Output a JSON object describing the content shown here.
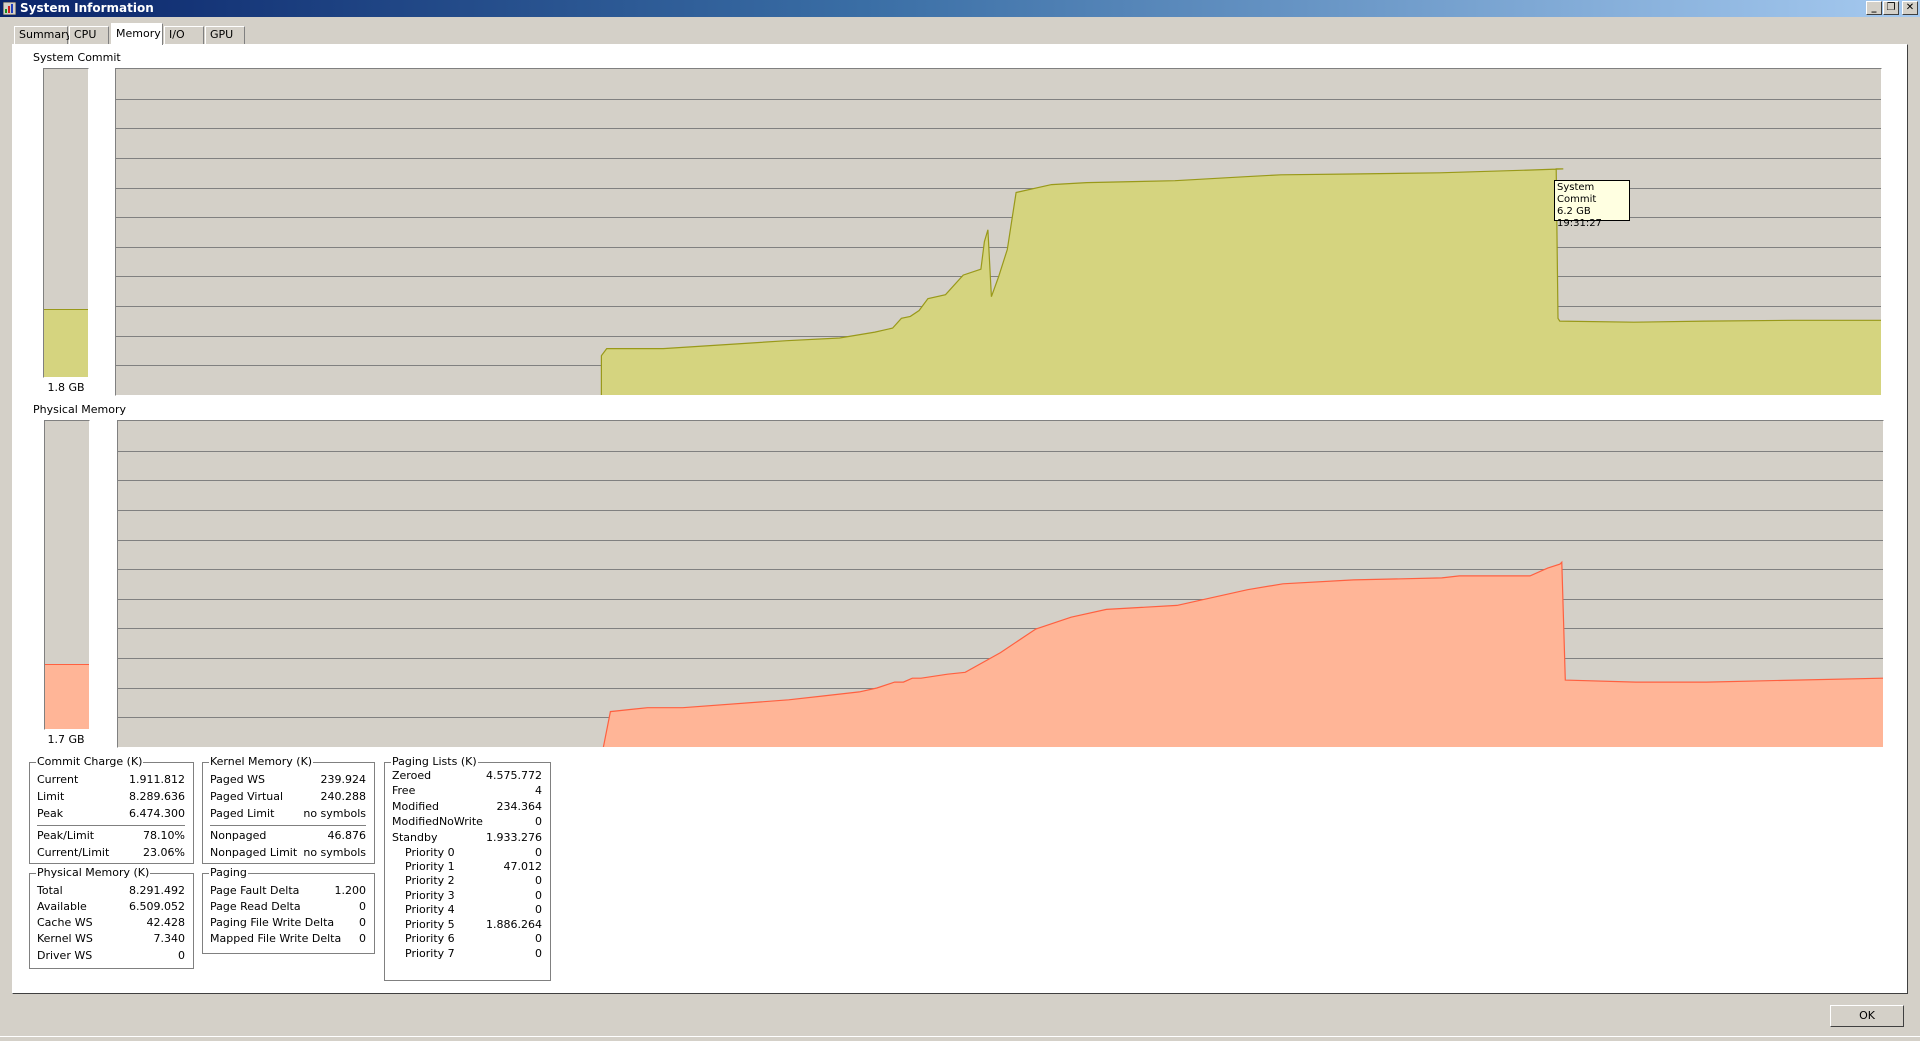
{
  "window": {
    "title": "System Information",
    "app_icon": "system-info-icon"
  },
  "tabs": [
    {
      "label": "Summary",
      "active": false
    },
    {
      "label": "CPU",
      "active": false
    },
    {
      "label": "Memory",
      "active": true
    },
    {
      "label": "I/O",
      "active": false
    },
    {
      "label": "GPU",
      "active": false
    }
  ],
  "colors": {
    "commit_fill": "#d5d47f",
    "commit_line": "#99991a",
    "physical_fill": "#ffb597",
    "physical_line": "#ff6040",
    "graph_bg": "#d4d0c8",
    "grid": "#808080"
  },
  "system_commit": {
    "label": "System Commit",
    "gauge_value": "1.8 GB",
    "gauge_fraction": 0.22,
    "tooltip": {
      "line1": "System Commit",
      "line2": "6.2 GB",
      "line3": "19:31:27"
    }
  },
  "physical_memory": {
    "label": "Physical Memory",
    "gauge_value": "1.7 GB",
    "gauge_fraction": 0.21
  },
  "commit_charge": {
    "title": "Commit Charge (K)",
    "rows": [
      {
        "label": "Current",
        "value": "1.911.812"
      },
      {
        "label": "Limit",
        "value": "8.289.636"
      },
      {
        "label": "Peak",
        "value": "6.474.300"
      }
    ],
    "rows2": [
      {
        "label": "Peak/Limit",
        "value": "78.10%"
      },
      {
        "label": "Current/Limit",
        "value": "23.06%"
      }
    ]
  },
  "kernel_memory": {
    "title": "Kernel Memory (K)",
    "rows": [
      {
        "label": "Paged WS",
        "value": "239.924"
      },
      {
        "label": "Paged Virtual",
        "value": "240.288"
      },
      {
        "label": "Paged Limit",
        "value": "no symbols"
      }
    ],
    "rows2": [
      {
        "label": "Nonpaged",
        "value": "46.876"
      },
      {
        "label": "Nonpaged Limit",
        "value": "no symbols"
      }
    ]
  },
  "paging_lists": {
    "title": "Paging Lists (K)",
    "rows": [
      {
        "label": "Zeroed",
        "value": "4.575.772"
      },
      {
        "label": "Free",
        "value": "4"
      },
      {
        "label": "Modified",
        "value": "234.364"
      },
      {
        "label": "ModifiedNoWrite",
        "value": "0"
      },
      {
        "label": "Standby",
        "value": "1.933.276"
      }
    ],
    "priorities": [
      {
        "label": "Priority 0",
        "value": "0"
      },
      {
        "label": "Priority 1",
        "value": "47.012"
      },
      {
        "label": "Priority 2",
        "value": "0"
      },
      {
        "label": "Priority 3",
        "value": "0"
      },
      {
        "label": "Priority 4",
        "value": "0"
      },
      {
        "label": "Priority 5",
        "value": "1.886.264"
      },
      {
        "label": "Priority 6",
        "value": "0"
      },
      {
        "label": "Priority 7",
        "value": "0"
      }
    ]
  },
  "physical_memory_k": {
    "title": "Physical Memory (K)",
    "rows": [
      {
        "label": "Total",
        "value": "8.291.492"
      },
      {
        "label": "Available",
        "value": "6.509.052"
      },
      {
        "label": "Cache WS",
        "value": "42.428"
      },
      {
        "label": "Kernel WS",
        "value": "7.340"
      },
      {
        "label": "Driver WS",
        "value": "0"
      }
    ]
  },
  "paging": {
    "title": "Paging",
    "rows": [
      {
        "label": "Page Fault Delta",
        "value": "1.200"
      },
      {
        "label": "Page Read Delta",
        "value": "0"
      },
      {
        "label": "Paging File Write Delta",
        "value": "0"
      },
      {
        "label": "Mapped File Write Delta",
        "value": "0"
      }
    ]
  },
  "ok_button": {
    "label": "OK"
  },
  "chart_data": [
    {
      "type": "area",
      "name": "system-commit-history",
      "ylim": [
        0,
        8.29
      ],
      "grid_rows": 11,
      "points_x_fraction": [
        0,
        0.274,
        0.275,
        0.278,
        0.31,
        0.38,
        0.41,
        0.43,
        0.44,
        0.445,
        0.45,
        0.455,
        0.46,
        0.47,
        0.48,
        0.49,
        0.492,
        0.494,
        0.496,
        0.5,
        0.505,
        0.51,
        0.53,
        0.55,
        0.6,
        0.64,
        0.66,
        0.7,
        0.75,
        0.8,
        0.82,
        0.816,
        0.817,
        0.818,
        0.86,
        0.9,
        0.95,
        1.0
      ],
      "values_gb": [
        null,
        null,
        1.0,
        1.18,
        1.18,
        1.38,
        1.45,
        1.6,
        1.7,
        1.95,
        2.0,
        2.15,
        2.45,
        2.55,
        3.05,
        3.2,
        3.9,
        4.2,
        2.5,
        3.0,
        3.7,
        5.15,
        5.35,
        5.4,
        5.45,
        5.55,
        5.6,
        5.62,
        5.65,
        5.72,
        5.75,
        5.75,
        1.95,
        1.88,
        1.85,
        1.88,
        1.9,
        1.9
      ]
    },
    {
      "type": "area",
      "name": "physical-memory-history",
      "ylim": [
        0,
        8.29
      ],
      "grid_rows": 11,
      "points_x_fraction": [
        0,
        0.274,
        0.275,
        0.279,
        0.3,
        0.32,
        0.38,
        0.4,
        0.42,
        0.43,
        0.44,
        0.445,
        0.45,
        0.455,
        0.47,
        0.48,
        0.5,
        0.52,
        0.54,
        0.56,
        0.58,
        0.6,
        0.64,
        0.66,
        0.7,
        0.75,
        0.76,
        0.8,
        0.81,
        0.817,
        0.818,
        0.82,
        0.86,
        0.9,
        0.95,
        1.0
      ],
      "values_gb": [
        null,
        null,
        0.0,
        0.9,
        1.0,
        1.0,
        1.2,
        1.3,
        1.4,
        1.5,
        1.65,
        1.65,
        1.75,
        1.75,
        1.85,
        1.9,
        2.4,
        3.0,
        3.3,
        3.5,
        3.55,
        3.6,
        4.0,
        4.15,
        4.25,
        4.3,
        4.35,
        4.35,
        4.55,
        4.65,
        4.7,
        1.7,
        1.65,
        1.65,
        1.7,
        1.75
      ]
    }
  ]
}
